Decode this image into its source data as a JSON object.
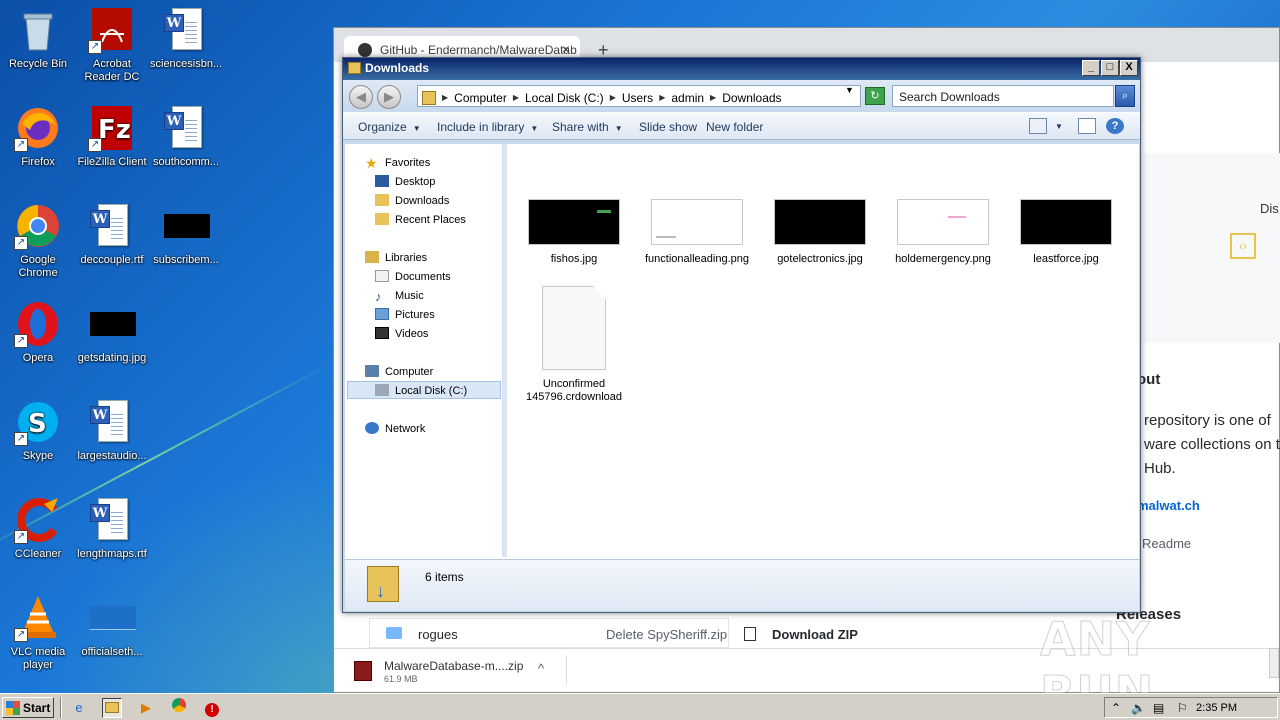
{
  "desktop": {
    "icons": [
      {
        "label": "Recycle Bin",
        "icon": "recycle-bin-icon"
      },
      {
        "label": "Acrobat Reader DC",
        "icon": "acrobat-icon"
      },
      {
        "label": "sciencesisbn...",
        "icon": "word-doc-icon"
      },
      {
        "label": "Firefox",
        "icon": "firefox-icon"
      },
      {
        "label": "FileZilla Client",
        "icon": "filezilla-icon"
      },
      {
        "label": "southcomm...",
        "icon": "word-doc-icon"
      },
      {
        "label": "Google Chrome",
        "icon": "chrome-icon"
      },
      {
        "label": "deccouple.rtf",
        "icon": "word-doc-icon"
      },
      {
        "label": "subscribem...",
        "icon": "image-thumb-icon"
      },
      {
        "label": "Opera",
        "icon": "opera-icon"
      },
      {
        "label": "getsdating.jpg",
        "icon": "image-thumb-icon"
      },
      {
        "label": "Skype",
        "icon": "skype-icon"
      },
      {
        "label": "largestaudio...",
        "icon": "word-doc-icon"
      },
      {
        "label": "CCleaner",
        "icon": "ccleaner-icon"
      },
      {
        "label": "lengthmaps.rtf",
        "icon": "word-doc-icon"
      },
      {
        "label": "VLC media player",
        "icon": "vlc-icon"
      },
      {
        "label": "officialseth...",
        "icon": "image-thumb-icon"
      }
    ]
  },
  "browser": {
    "tab_title": "GitHub - Endermanch/MalwareDatab",
    "tab_close": "×",
    "new_tab": "+",
    "side_partial": "Disı",
    "about_heading": "out",
    "about_line1": "repository is one of",
    "about_line2": "ware collections on t",
    "about_line3": "Hub.",
    "site_link": "malwat.ch",
    "readme": "Readme",
    "releases": "Releases",
    "file_row": {
      "name": "rogues",
      "commit_msg": "Delete SpySheriff.zip"
    },
    "download_zip": "Download ZIP",
    "download_shelf": {
      "file": "MalwareDatabase-m....zip",
      "size": "61.9 MB"
    }
  },
  "explorer": {
    "title": "Downloads",
    "window_buttons": {
      "minimize": "_",
      "maximize": "□",
      "close": "X"
    },
    "breadcrumb": [
      "Computer",
      "Local Disk (C:)",
      "Users",
      "admin",
      "Downloads"
    ],
    "search_placeholder": "Search Downloads",
    "toolbar": {
      "organize": "Organize",
      "include_in_library": "Include in library",
      "share_with": "Share with",
      "slide_show": "Slide show",
      "new_folder": "New folder"
    },
    "nav": {
      "favorites": "Favorites",
      "desktop": "Desktop",
      "downloads": "Downloads",
      "recent_places": "Recent Places",
      "libraries": "Libraries",
      "documents": "Documents",
      "music": "Music",
      "pictures": "Pictures",
      "videos": "Videos",
      "computer": "Computer",
      "local_disk": "Local Disk (C:)",
      "network": "Network"
    },
    "files": [
      {
        "name": "fishos.jpg",
        "thumb": "black"
      },
      {
        "name": "functionalleading.png",
        "thumb": "white"
      },
      {
        "name": "gotelectronics.jpg",
        "thumb": "black"
      },
      {
        "name": "holdemergency.png",
        "thumb": "white"
      },
      {
        "name": "leastforce.jpg",
        "thumb": "black"
      },
      {
        "name": "Unconfirmed 145796.crdownload",
        "thumb": "blank"
      }
    ],
    "status": "6 items"
  },
  "taskbar": {
    "start_label": "Start",
    "clock": "2:35 PM"
  },
  "watermark": "ANY RUN",
  "colors": {
    "desktop_blue": "#1b77d6",
    "title_bar": "#0a246a",
    "taskbar": "#d4d0c8"
  }
}
